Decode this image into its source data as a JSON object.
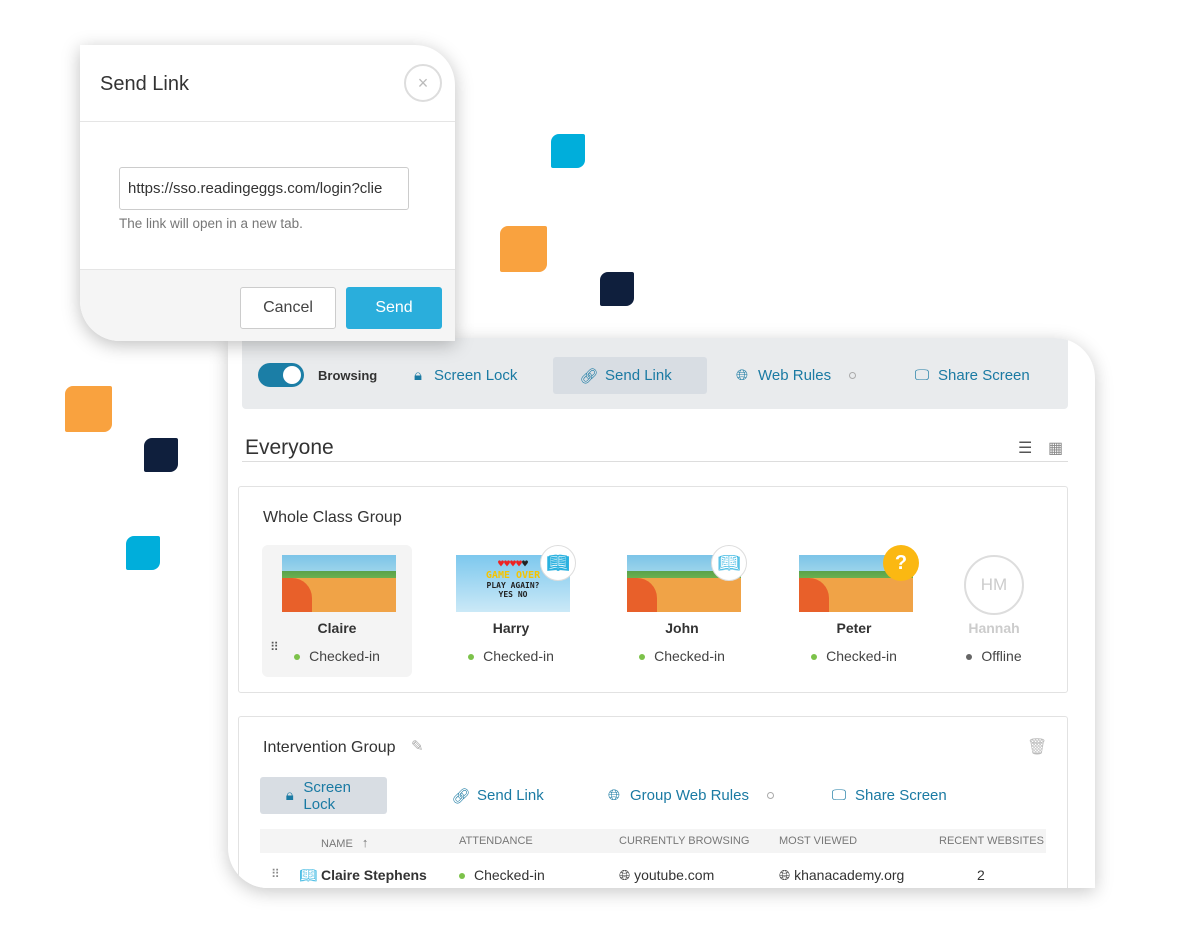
{
  "colors": {
    "accent": "#1a7aa3",
    "send": "#2aaedc",
    "orange": "#f9a23f",
    "navy": "#0f1f3d",
    "cyan": "#00aedb"
  },
  "dialog": {
    "title": "Send Link",
    "close_icon": "close-icon",
    "url_value": "https://sso.readingeggs.com/login?clie",
    "hint": "The link will open in a new tab.",
    "cancel": "Cancel",
    "send": "Send"
  },
  "toolbar": {
    "browsing_label": "Browsing",
    "browsing_on": true,
    "screen_lock": "Screen Lock",
    "send_link": "Send Link",
    "web_rules": "Web Rules",
    "share_screen": "Share Screen"
  },
  "main": {
    "title": "Everyone"
  },
  "whole_class": {
    "title": "Whole Class Group",
    "students": [
      {
        "name": "Claire",
        "status": "Checked-in"
      },
      {
        "name": "Harry",
        "status": "Checked-in",
        "badge": "book-icon",
        "screen_text": "GAME OVER",
        "screen_sub": "PLAY AGAIN?",
        "screen_opts": "YES  NO"
      },
      {
        "name": "John",
        "status": "Checked-in",
        "badge": "book-icon"
      },
      {
        "name": "Peter",
        "status": "Checked-in",
        "badge": "question-icon"
      },
      {
        "name": "Hannah",
        "status": "Offline",
        "initials": "HM"
      }
    ]
  },
  "intervention": {
    "title": "Intervention Group",
    "screen_lock": "Screen Lock",
    "send_link": "Send Link",
    "web_rules": "Group Web Rules",
    "share_screen": "Share Screen",
    "columns": [
      "NAME",
      "ATTENDANCE",
      "CURRENTLY BROWSING",
      "MOST VIEWED",
      "RECENT WEBSITES"
    ],
    "rows": [
      {
        "name": "Claire Stephens",
        "attendance": "Checked-in",
        "browsing": "youtube.com",
        "most_viewed": "khanacademy.org",
        "recent": "2"
      }
    ]
  }
}
